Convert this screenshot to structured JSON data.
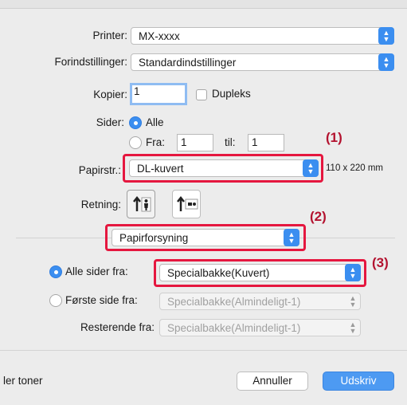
{
  "printer": {
    "label": "Printer:",
    "value": "MX-xxxx"
  },
  "presets": {
    "label": "Forindstillinger:",
    "value": "Standardindstillinger"
  },
  "copies": {
    "label": "Kopier:",
    "value": "1",
    "duplex_label": "Dupleks"
  },
  "pages": {
    "label": "Sider:",
    "all_label": "Alle",
    "from_label": "Fra:",
    "from_value": "1",
    "to_label": "til:",
    "to_value": "1"
  },
  "paper_size": {
    "label": "Papirstr.:",
    "value": "DL-kuvert",
    "dimensions": "110 x 220 mm"
  },
  "orientation": {
    "label": "Retning:"
  },
  "section": {
    "value": "Papirforsyning"
  },
  "paper_feed": {
    "all_pages_label": "Alle sider fra:",
    "all_pages_value": "Specialbakke(Kuvert)",
    "first_page_label": "Første side fra:",
    "first_page_value": "Specialbakke(Almindeligt-1)",
    "remaining_label": "Resterende fra:",
    "remaining_value": "Specialbakke(Almindeligt-1)"
  },
  "callouts": {
    "one": "(1)",
    "two": "(2)",
    "three": "(3)"
  },
  "footer": {
    "left_text": "ler toner",
    "cancel_label": "Annuller",
    "print_label": "Udskriv"
  },
  "colors": {
    "accent": "#3b8ef0",
    "callout_border": "#e5173f",
    "callout_text": "#b3122f",
    "background": "#ececec"
  }
}
